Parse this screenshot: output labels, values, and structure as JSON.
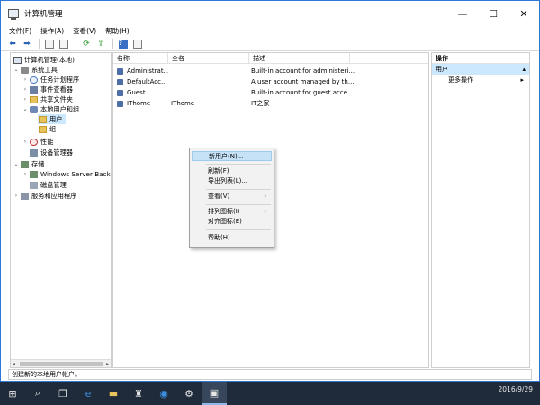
{
  "window": {
    "title": "计算机管理",
    "controls": {
      "minimize": "—",
      "maximize": "☐",
      "close": "✕"
    }
  },
  "menu": [
    "文件(F)",
    "操作(A)",
    "查看(V)",
    "帮助(H)"
  ],
  "tree": {
    "root": "计算机管理(本地)",
    "system_tools": "系统工具",
    "task_scheduler": "任务计划程序",
    "event_viewer": "事件查看器",
    "shared_folders": "共享文件夹",
    "local_users": "本地用户和组",
    "users": "用户",
    "groups": "组",
    "performance": "性能",
    "device_manager": "设备管理器",
    "storage": "存储",
    "windows_server_backup": "Windows Server Back",
    "disk_management": "磁盘管理",
    "services_apps": "服务和应用程序"
  },
  "list": {
    "columns": [
      "名称",
      "全名",
      "描述"
    ],
    "rows": [
      {
        "name": "Administrat...",
        "fullname": "",
        "desc": "Built-in account for administeri..."
      },
      {
        "name": "DefaultAcc...",
        "fullname": "",
        "desc": "A user account managed by th..."
      },
      {
        "name": "Guest",
        "fullname": "",
        "desc": "Built-in account for guest acce..."
      },
      {
        "name": "IThome",
        "fullname": "IThome",
        "desc": "IT之家"
      }
    ]
  },
  "actions": {
    "header": "操作",
    "section": "用户",
    "more": "更多操作",
    "arrow": "▸"
  },
  "context_menu": {
    "new_user": "新用户(N)...",
    "refresh": "刷新(F)",
    "export": "导出列表(L)...",
    "view": "查看(V)",
    "arrange": "排列图标(I)",
    "align": "对齐图标(E)",
    "help": "帮助(H)",
    "submenu_arrow": "›"
  },
  "status": "创建新的本地用户帐户。",
  "taskbar": {
    "date": "2016/9/29"
  }
}
